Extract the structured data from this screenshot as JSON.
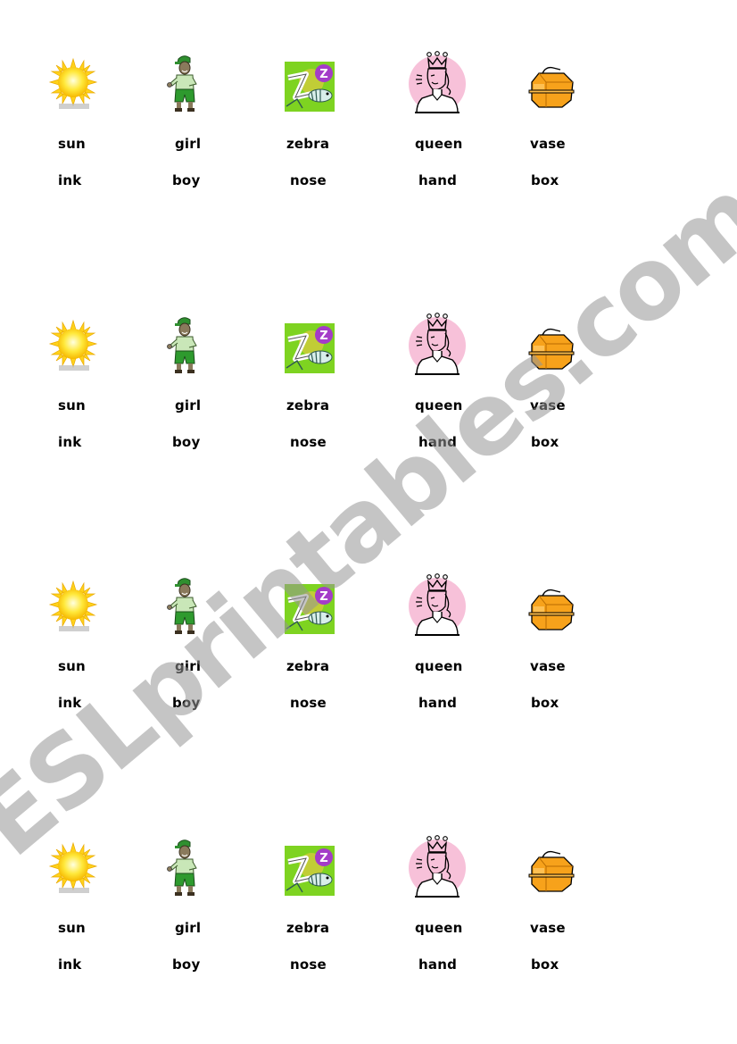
{
  "worksheet": {
    "blocks": [
      {
        "items": [
          {
            "icon": "sun-icon",
            "word1": "sun",
            "word2": "ink"
          },
          {
            "icon": "boy-icon",
            "word1": "girl",
            "word2": "boy"
          },
          {
            "icon": "zebra-icon",
            "word1": "zebra",
            "word2": "nose"
          },
          {
            "icon": "queen-icon",
            "word1": "queen",
            "word2": "hand"
          },
          {
            "icon": "box-icon",
            "word1": "vase",
            "word2": "box"
          }
        ]
      },
      {
        "items": [
          {
            "icon": "sun-icon",
            "word1": "sun",
            "word2": "ink"
          },
          {
            "icon": "boy-icon",
            "word1": "girl",
            "word2": "boy"
          },
          {
            "icon": "zebra-icon",
            "word1": "zebra",
            "word2": "nose"
          },
          {
            "icon": "queen-icon",
            "word1": "queen",
            "word2": "hand"
          },
          {
            "icon": "box-icon",
            "word1": "vase",
            "word2": "box"
          }
        ]
      },
      {
        "items": [
          {
            "icon": "sun-icon",
            "word1": "sun",
            "word2": "ink"
          },
          {
            "icon": "boy-icon",
            "word1": "girl",
            "word2": "boy"
          },
          {
            "icon": "zebra-icon",
            "word1": "zebra",
            "word2": "nose"
          },
          {
            "icon": "queen-icon",
            "word1": "queen",
            "word2": "hand"
          },
          {
            "icon": "box-icon",
            "word1": "vase",
            "word2": "box"
          }
        ]
      },
      {
        "items": [
          {
            "icon": "sun-icon",
            "word1": "sun",
            "word2": "ink"
          },
          {
            "icon": "boy-icon",
            "word1": "girl",
            "word2": "boy"
          },
          {
            "icon": "zebra-icon",
            "word1": "zebra",
            "word2": "nose"
          },
          {
            "icon": "queen-icon",
            "word1": "queen",
            "word2": "hand"
          },
          {
            "icon": "box-icon",
            "word1": "vase",
            "word2": "box"
          }
        ]
      }
    ]
  },
  "watermark": {
    "text": "ESLprintables.com",
    "color": "#969696"
  },
  "colors": {
    "sun": "#ffd700",
    "zebra_bg": "#7ed321",
    "queen_bg": "#f7c1d9",
    "box": "#f7a21b"
  }
}
